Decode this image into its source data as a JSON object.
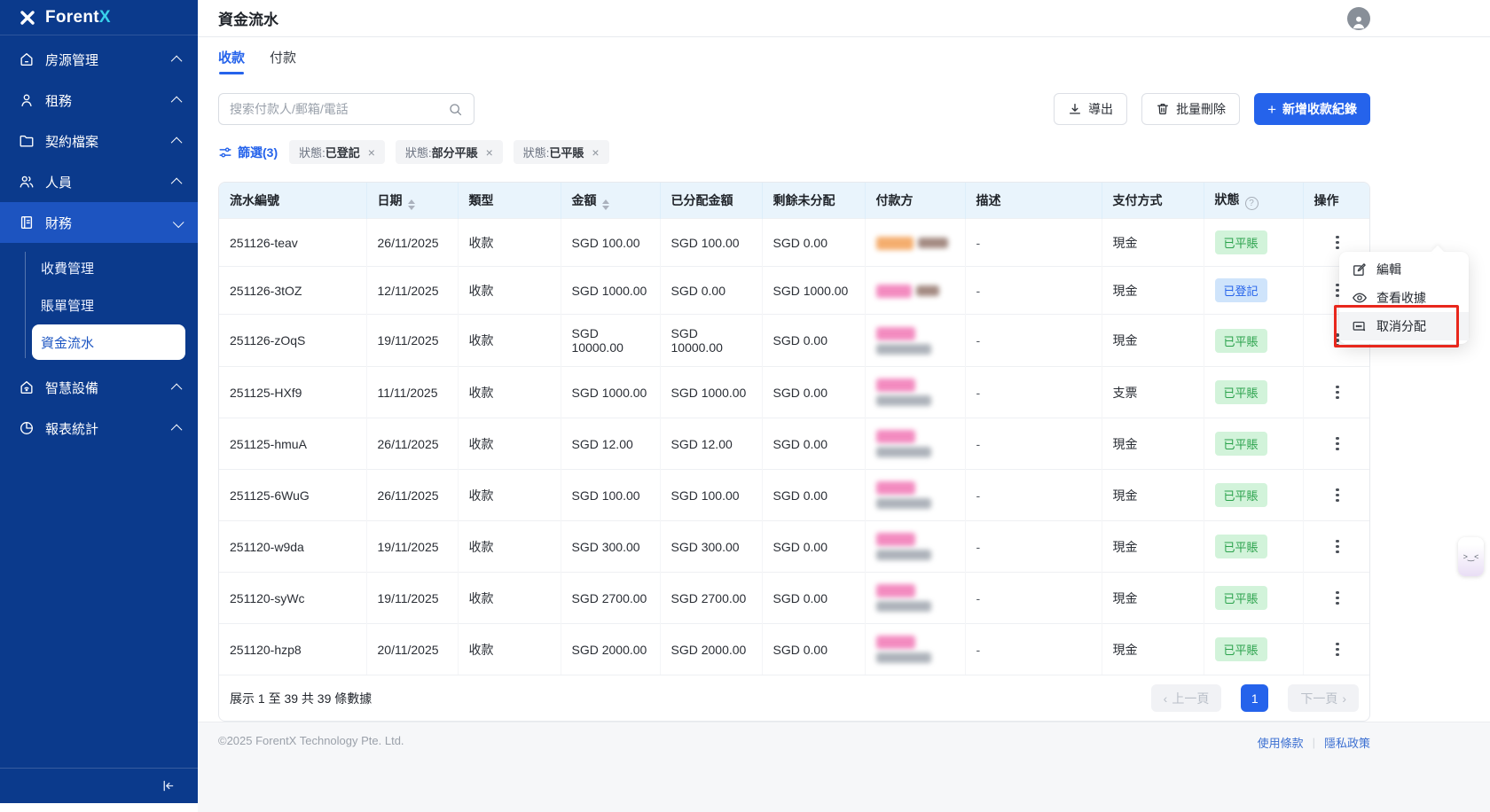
{
  "brand": {
    "name_left": "Forent",
    "name_right": "X"
  },
  "sidebar": {
    "items": [
      {
        "key": "properties",
        "label": "房源管理",
        "icon": "home-icon",
        "chevron": "up",
        "active": false
      },
      {
        "key": "leasing",
        "label": "租務",
        "icon": "user-icon",
        "chevron": "up",
        "active": false
      },
      {
        "key": "contracts",
        "label": "契約檔案",
        "icon": "folder-icon",
        "chevron": "up",
        "active": false
      },
      {
        "key": "people",
        "label": "人員",
        "icon": "users-icon",
        "chevron": "up",
        "active": false
      },
      {
        "key": "finance",
        "label": "財務",
        "icon": "finance-icon",
        "chevron": "down",
        "active": true
      },
      {
        "key": "devices",
        "label": "智慧設備",
        "icon": "device-icon",
        "chevron": "up",
        "active": false
      },
      {
        "key": "reports",
        "label": "報表統計",
        "icon": "chart-icon",
        "chevron": "up",
        "active": false
      }
    ],
    "finance_children": [
      {
        "key": "fees",
        "label": "收費管理",
        "active": false
      },
      {
        "key": "bills",
        "label": "賬單管理",
        "active": false
      },
      {
        "key": "cashflow",
        "label": "資金流水",
        "active": true
      }
    ]
  },
  "header": {
    "title": "資金流水"
  },
  "tabs": [
    {
      "label": "收款",
      "active": true
    },
    {
      "label": "付款",
      "active": false
    }
  ],
  "toolbar": {
    "search_placeholder": "搜索付款人/郵箱/電話",
    "export_label": "導出",
    "bulk_delete_label": "批量刪除",
    "add_label": "新增收款紀錄"
  },
  "filters": {
    "filter_label": "篩選(3)",
    "chips": [
      {
        "prefix": "狀態",
        "value": "已登記"
      },
      {
        "prefix": "狀態",
        "value": "部分平賬"
      },
      {
        "prefix": "狀態",
        "value": "已平賬"
      }
    ]
  },
  "table": {
    "columns": [
      {
        "label": "流水編號"
      },
      {
        "label": "日期",
        "sortable": true
      },
      {
        "label": "類型"
      },
      {
        "label": "金額",
        "sortable": true
      },
      {
        "label": "已分配金額"
      },
      {
        "label": "剩餘未分配"
      },
      {
        "label": "付款方"
      },
      {
        "label": "描述"
      },
      {
        "label": "支付方式"
      },
      {
        "label": "狀態",
        "help": true
      },
      {
        "label": "操作"
      }
    ],
    "rows": [
      {
        "id": "251126-teav",
        "date": "26/11/2025",
        "type": "收款",
        "amount": "SGD 100.00",
        "allocated": "SGD 100.00",
        "remaining": "SGD 0.00",
        "payer_redacted": true,
        "payer_style": "inline-warm",
        "desc": "-",
        "method": "現金",
        "status": "已平賬",
        "status_type": "green"
      },
      {
        "id": "251126-3tOZ",
        "date": "12/11/2025",
        "type": "收款",
        "amount": "SGD 1000.00",
        "allocated": "SGD 0.00",
        "remaining": "SGD 1000.00",
        "payer_redacted": true,
        "payer_style": "inline-pink",
        "desc": "-",
        "method": "現金",
        "status": "已登記",
        "status_type": "blue"
      },
      {
        "id": "251126-zOqS",
        "date": "19/11/2025",
        "type": "收款",
        "amount": "SGD 10000.00",
        "allocated": "SGD 10000.00",
        "remaining": "SGD 0.00",
        "payer_redacted": true,
        "payer_style": "stacked",
        "desc": "-",
        "method": "現金",
        "status": "已平賬",
        "status_type": "green"
      },
      {
        "id": "251125-HXf9",
        "date": "11/11/2025",
        "type": "收款",
        "amount": "SGD 1000.00",
        "allocated": "SGD 1000.00",
        "remaining": "SGD 0.00",
        "payer_redacted": true,
        "payer_style": "stacked",
        "desc": "-",
        "method": "支票",
        "status": "已平賬",
        "status_type": "green"
      },
      {
        "id": "251125-hmuA",
        "date": "26/11/2025",
        "type": "收款",
        "amount": "SGD 12.00",
        "allocated": "SGD 12.00",
        "remaining": "SGD 0.00",
        "payer_redacted": true,
        "payer_style": "stacked",
        "desc": "-",
        "method": "現金",
        "status": "已平賬",
        "status_type": "green"
      },
      {
        "id": "251125-6WuG",
        "date": "26/11/2025",
        "type": "收款",
        "amount": "SGD 100.00",
        "allocated": "SGD 100.00",
        "remaining": "SGD 0.00",
        "payer_redacted": true,
        "payer_style": "stacked",
        "desc": "-",
        "method": "現金",
        "status": "已平賬",
        "status_type": "green"
      },
      {
        "id": "251120-w9da",
        "date": "19/11/2025",
        "type": "收款",
        "amount": "SGD 300.00",
        "allocated": "SGD 300.00",
        "remaining": "SGD 0.00",
        "payer_redacted": true,
        "payer_style": "stacked",
        "desc": "-",
        "method": "現金",
        "status": "已平賬",
        "status_type": "green"
      },
      {
        "id": "251120-syWc",
        "date": "19/11/2025",
        "type": "收款",
        "amount": "SGD 2700.00",
        "allocated": "SGD 2700.00",
        "remaining": "SGD 0.00",
        "payer_redacted": true,
        "payer_style": "stacked",
        "desc": "-",
        "method": "現金",
        "status": "已平賬",
        "status_type": "green"
      },
      {
        "id": "251120-hzp8",
        "date": "20/11/2025",
        "type": "收款",
        "amount": "SGD 2000.00",
        "allocated": "SGD 2000.00",
        "remaining": "SGD 0.00",
        "payer_redacted": true,
        "payer_style": "stacked",
        "desc": "-",
        "method": "現金",
        "status": "已平賬",
        "status_type": "green"
      }
    ]
  },
  "context_menu": {
    "items": [
      {
        "label": "編輯",
        "icon": "edit-icon",
        "highlighted": false
      },
      {
        "label": "查看收據",
        "icon": "eye-icon",
        "highlighted": false
      },
      {
        "label": "取消分配",
        "icon": "card-icon",
        "highlighted": true
      }
    ]
  },
  "pagination": {
    "summary": "展示 1 至 39 共 39 條數據",
    "prev_label": "上一頁",
    "current_page": "1",
    "next_label": "下一頁"
  },
  "footer": {
    "copyright": "©2025 ForentX Technology Pte. Ltd.",
    "links": [
      "使用條款",
      "隱私政策"
    ]
  },
  "widget": {
    "face": ">‿<"
  },
  "colors": {
    "accent_blue": "#2563eb",
    "sidebar_bg": "#0b3a8c",
    "sidebar_active_bg": "#1d54c0",
    "logo_accent": "#39d1ea",
    "table_header_bg": "#e9f4fc",
    "badge_green_bg": "#d2f3da",
    "badge_green_text": "#2ba24c",
    "badge_blue_bg": "#cfe4fb",
    "badge_blue_text": "#2563eb",
    "annotation_red": "#e8271c"
  }
}
